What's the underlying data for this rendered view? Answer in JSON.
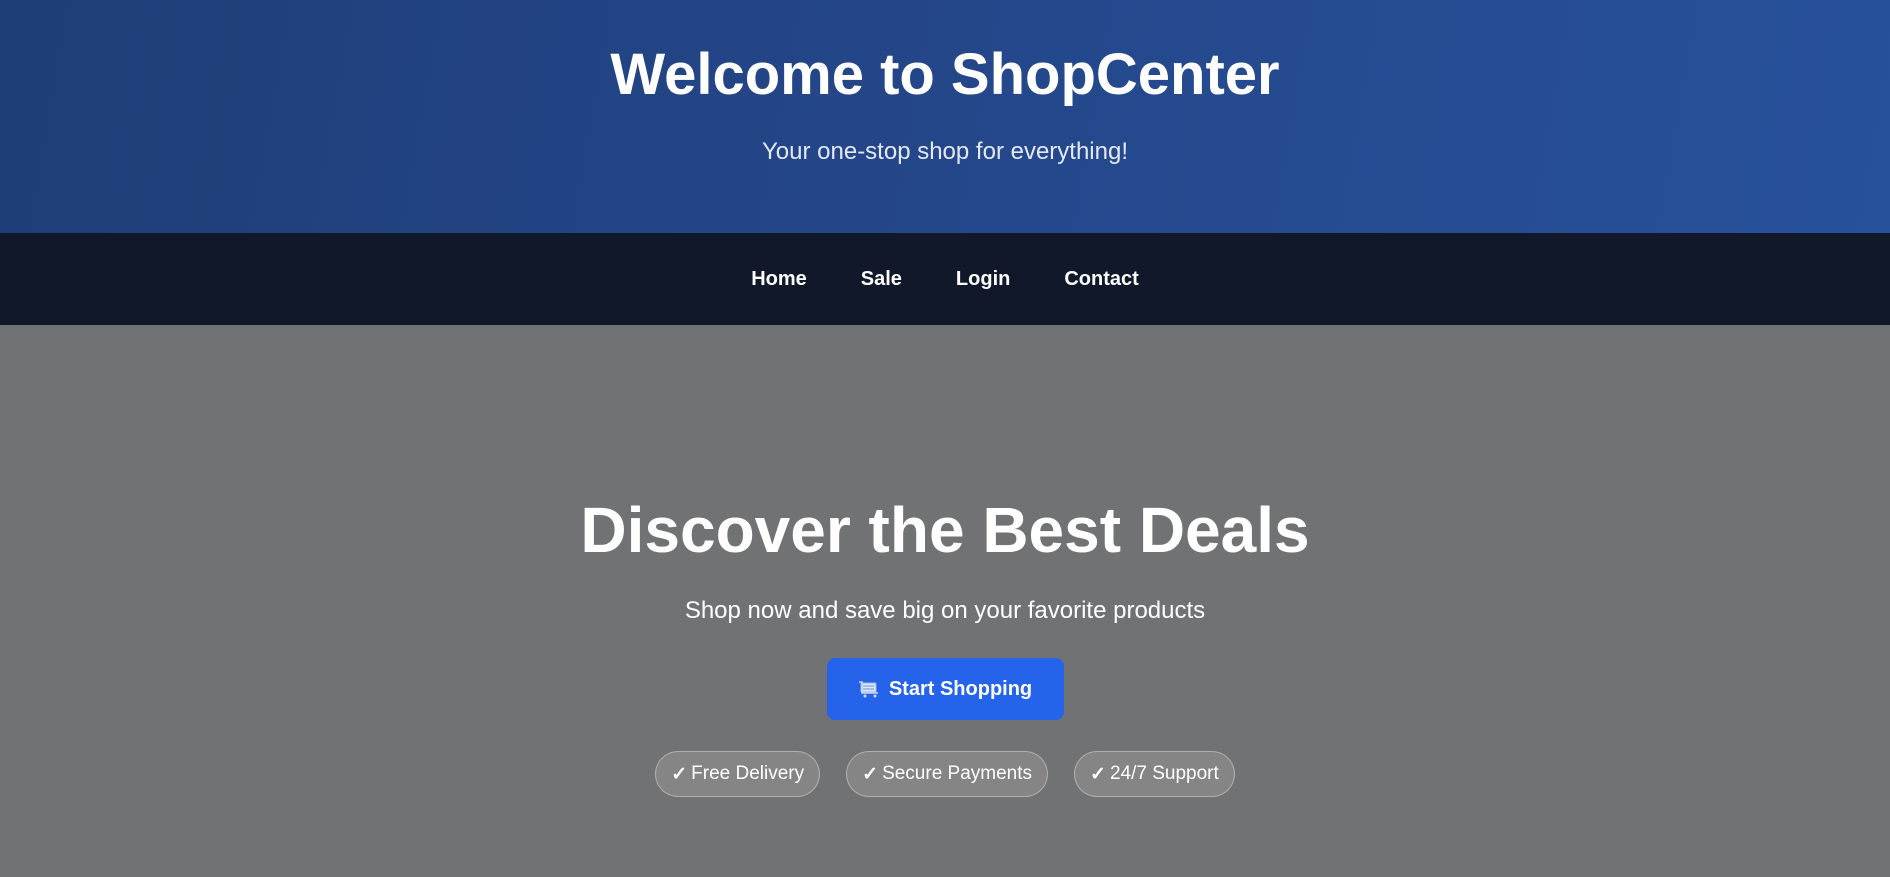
{
  "header": {
    "title": "Welcome to ShopCenter",
    "subtitle": "Your one-stop shop for everything!"
  },
  "nav": {
    "items": [
      {
        "label": "Home"
      },
      {
        "label": "Sale"
      },
      {
        "label": "Login"
      },
      {
        "label": "Contact"
      }
    ]
  },
  "hero": {
    "title": "Discover the Best Deals",
    "subtitle": "Shop now and save big on your favorite products",
    "cta": {
      "label": "Start Shopping",
      "icon": "shopping-cart-icon"
    },
    "badges": [
      {
        "check": "✓",
        "label": "Free Delivery"
      },
      {
        "check": "✓",
        "label": "Secure Payments"
      },
      {
        "check": "✓",
        "label": "24/7 Support"
      }
    ]
  },
  "colors": {
    "header_bg": "#24478a",
    "nav_bg": "#10182a",
    "hero_bg": "#717273",
    "accent": "#2563eb"
  }
}
